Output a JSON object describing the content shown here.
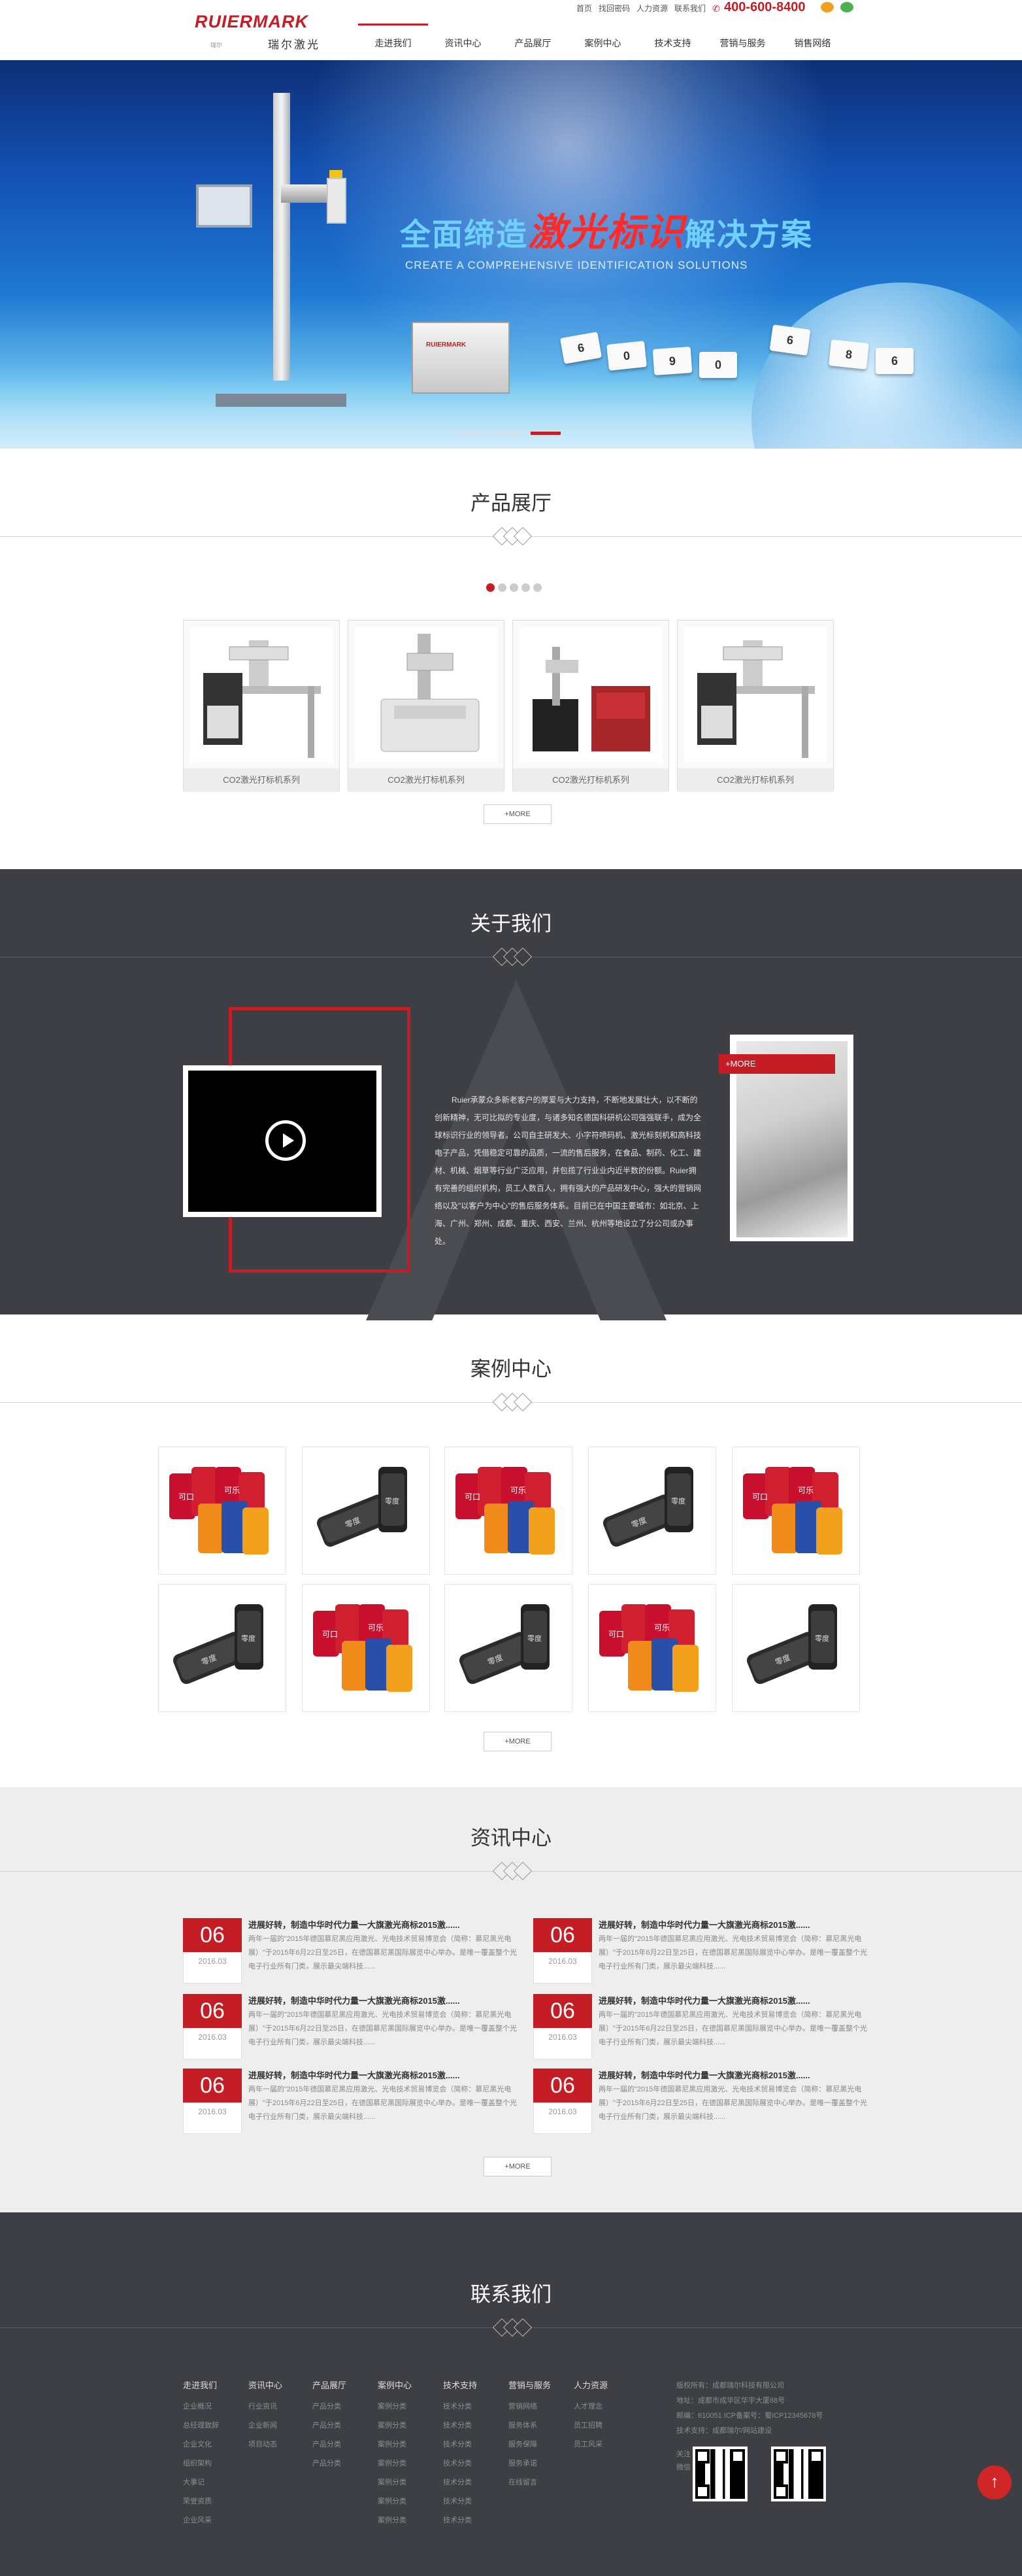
{
  "header": {
    "logo_text": "RUIERMARK",
    "logo_cn": "瑞尔激光",
    "logo_sub": "瑞尔",
    "top_links": [
      "首页",
      "找回密码",
      "人力资源",
      "联系我们"
    ],
    "phone": "400-600-8400",
    "nav": [
      "走进我们",
      "资讯中心",
      "产品展厅",
      "案例中心",
      "技术支持",
      "营销与服务",
      "销售网络"
    ],
    "active_nav_index": 0
  },
  "banner": {
    "slogan_part1": "全面缔造",
    "slogan_highlight": "激光标识",
    "slogan_part2": "解决方案",
    "slogan_en": "CREATE A COMPREHENSIVE IDENTIFICATION SOLUTIONS",
    "box_label": "RUIERMARK",
    "tiles": [
      "6",
      "0",
      "9",
      "0",
      "6",
      "8",
      "6"
    ],
    "slide_count": 3,
    "active_slide": 2
  },
  "products": {
    "title": "产品展厅",
    "page_count": 5,
    "active_page": 0,
    "items": [
      "CO2激光打标机系列",
      "CO2激光打标机系列",
      "CO2激光打标机系列",
      "CO2激光打标机系列"
    ],
    "more": "+MORE"
  },
  "about": {
    "title": "关于我们",
    "text": "Ruier承蒙众多新老客户的厚爱与大力支持，不断地发展壮大，以不断的创新精神，无可比拟的专业度，与诸多知名德国科研机公司强强联手，成为全球标识行业的领导者。公司自主研发大、小字符喷码机、激光标刻机和高科技电子产品，凭借稳定可靠的品质，一流的售后服务，在食品、制药、化工、建材、机械、烟草等行业广泛应用，并包揽了行业业内近半数的份额。Ruier拥有完善的组织机构，员工人数百人，拥有强大的产品研发中心，强大的营销网络以及\"以客户为中心\"的售后服务体系。目前已在中国主要城市：如北京、上海、广州、郑州、成都、重庆、西安、兰州、杭州等地设立了分公司或办事处。",
    "more": "+MORE"
  },
  "cases": {
    "title": "案例中心",
    "items": [
      "cola-red",
      "cola-black",
      "cola-red",
      "cola-black",
      "cola-red",
      "cola-black",
      "cola-red",
      "cola-black",
      "cola-red",
      "cola-black"
    ],
    "more": "+MORE"
  },
  "news": {
    "title": "资讯中心",
    "items": [
      {
        "day": "06",
        "ym": "2016.03",
        "title": "进展好转，制造中华时代力量一大旗激光商标2015激......",
        "desc": "两年一届的\"2015年德国慕尼黑应用激光、光电技术贸易博览会（简称：慕尼黑光电展）\"于2015年6月22日至25日，在德国慕尼黑国际展览中心举办。是唯一覆盖整个光电子行业所有门类，展示最尖端科技......"
      },
      {
        "day": "06",
        "ym": "2016.03",
        "title": "进展好转，制造中华时代力量一大旗激光商标2015激......",
        "desc": "两年一届的\"2015年德国慕尼黑应用激光、光电技术贸易博览会（简称：慕尼黑光电展）\"于2015年6月22日至25日，在德国慕尼黑国际展览中心举办。是唯一覆盖整个光电子行业所有门类，展示最尖端科技......"
      },
      {
        "day": "06",
        "ym": "2016.03",
        "title": "进展好转，制造中华时代力量一大旗激光商标2015激......",
        "desc": "两年一届的\"2015年德国慕尼黑应用激光、光电技术贸易博览会（简称：慕尼黑光电展）\"于2015年6月22日至25日，在德国慕尼黑国际展览中心举办。是唯一覆盖整个光电子行业所有门类，展示最尖端科技......"
      },
      {
        "day": "06",
        "ym": "2016.03",
        "title": "进展好转，制造中华时代力量一大旗激光商标2015激......",
        "desc": "两年一届的\"2015年德国慕尼黑应用激光、光电技术贸易博览会（简称：慕尼黑光电展）\"于2015年6月22日至25日，在德国慕尼黑国际展览中心举办。是唯一覆盖整个光电子行业所有门类，展示最尖端科技......"
      },
      {
        "day": "06",
        "ym": "2016.03",
        "title": "进展好转，制造中华时代力量一大旗激光商标2015激......",
        "desc": "两年一届的\"2015年德国慕尼黑应用激光、光电技术贸易博览会（简称：慕尼黑光电展）\"于2015年6月22日至25日，在德国慕尼黑国际展览中心举办。是唯一覆盖整个光电子行业所有门类，展示最尖端科技......"
      },
      {
        "day": "06",
        "ym": "2016.03",
        "title": "进展好转，制造中华时代力量一大旗激光商标2015激......",
        "desc": "两年一届的\"2015年德国慕尼黑应用激光、光电技术贸易博览会（简称：慕尼黑光电展）\"于2015年6月22日至25日，在德国慕尼黑国际展览中心举办。是唯一覆盖整个光电子行业所有门类，展示最尖端科技......"
      }
    ],
    "more": "+MORE"
  },
  "contact": {
    "title": "联系我们",
    "columns": [
      {
        "head": "走进我们",
        "items": [
          "企业概况",
          "总经理致辞",
          "企业文化",
          "组织架构",
          "大事记",
          "荣誉资质",
          "企业风采"
        ]
      },
      {
        "head": "资讯中心",
        "items": [
          "行业资讯",
          "企业新闻",
          "项目动态"
        ]
      },
      {
        "head": "产品展厅",
        "items": [
          "产品分类",
          "产品分类",
          "产品分类",
          "产品分类"
        ]
      },
      {
        "head": "案例中心",
        "items": [
          "案例分类",
          "案例分类",
          "案例分类",
          "案例分类",
          "案例分类",
          "案例分类",
          "案例分类"
        ]
      },
      {
        "head": "技术支持",
        "items": [
          "技术分类",
          "技术分类",
          "技术分类",
          "技术分类",
          "技术分类",
          "技术分类",
          "技术分类"
        ]
      },
      {
        "head": "营销与服务",
        "items": [
          "营销网络",
          "服务体系",
          "服务保障",
          "服务承诺",
          "在线留言"
        ]
      },
      {
        "head": "人力资源",
        "items": [
          "人才理念",
          "员工招聘",
          "员工风采"
        ]
      }
    ],
    "info": [
      "版权所有：成都瑞尔科技有限公司",
      "地址：成都市成华区华宇大厦88号",
      "邮编：610051 ICP备案号：蜀ICP12345678号",
      "技术支持：成都瑞尔/网站建设"
    ],
    "qr_label": "关注微信"
  },
  "to_top": "↑"
}
